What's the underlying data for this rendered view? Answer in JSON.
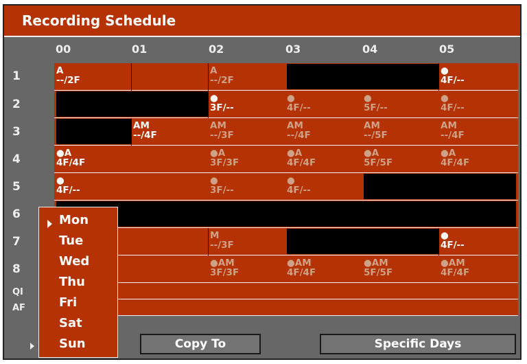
{
  "title": "Recording Schedule",
  "columns": [
    "00",
    "01",
    "02",
    "03",
    "04",
    "05"
  ],
  "rows": [
    "1",
    "2",
    "3",
    "4",
    "5",
    "6",
    "7",
    "8",
    "QI",
    "AF"
  ],
  "entries": {
    "r1c0": {
      "l1": "A",
      "l2": "--/2F"
    },
    "r1c2": {
      "l1": "A",
      "l2": "--/2F"
    },
    "r1c5": {
      "l1": "●",
      "l2": "4F/--"
    },
    "r2c2": {
      "l1": "●",
      "l2": "3F/--"
    },
    "r2c3": {
      "l1": "●",
      "l2": "4F/--"
    },
    "r2c4": {
      "l1": "●",
      "l2": "5F/--"
    },
    "r2c5": {
      "l1": "●",
      "l2": "4F/--"
    },
    "r3c1": {
      "l1": "AM",
      "l2": "--/4F"
    },
    "r3c2": {
      "l1": "AM",
      "l2": "--/3F"
    },
    "r3c3": {
      "l1": "AM",
      "l2": "--/4F"
    },
    "r3c4": {
      "l1": "AM",
      "l2": "--/5F"
    },
    "r3c5": {
      "l1": "AM",
      "l2": "--/4F"
    },
    "r4c0": {
      "l1": "●A",
      "l2": "4F/4F"
    },
    "r4c2": {
      "l1": "●A",
      "l2": "3F/3F"
    },
    "r4c3": {
      "l1": "●A",
      "l2": "4F/4F"
    },
    "r4c4": {
      "l1": "●A",
      "l2": "5F/5F"
    },
    "r4c5": {
      "l1": "●A",
      "l2": "4F/4F"
    },
    "r5c0": {
      "l1": "●",
      "l2": "4F/--"
    },
    "r5c2": {
      "l1": "●",
      "l2": "3F/--"
    },
    "r5c3": {
      "l1": "●",
      "l2": "4F/--"
    },
    "r7c2": {
      "l1": "M",
      "l2": "--/3F"
    },
    "r7c5": {
      "l1": "●",
      "l2": "4F/--"
    },
    "r8c2": {
      "l1": "●AM",
      "l2": "3F/3F"
    },
    "r8c3": {
      "l1": "●AM",
      "l2": "4F/4F"
    },
    "r8c4": {
      "l1": "●AM",
      "l2": "5F/5F"
    },
    "r8c5": {
      "l1": "●AM",
      "l2": "4F/4F"
    }
  },
  "days": [
    "Mon",
    "Tue",
    "Wed",
    "Thu",
    "Fri",
    "Sat",
    "Sun"
  ],
  "selected_day": "Mon",
  "buttons": {
    "copy_to": "Copy To",
    "specific_days": "Specific Days"
  },
  "colors": {
    "accent": "#b43203",
    "blocked": "#000000",
    "panel": "#676767",
    "inactive_text": "#cfa189"
  }
}
